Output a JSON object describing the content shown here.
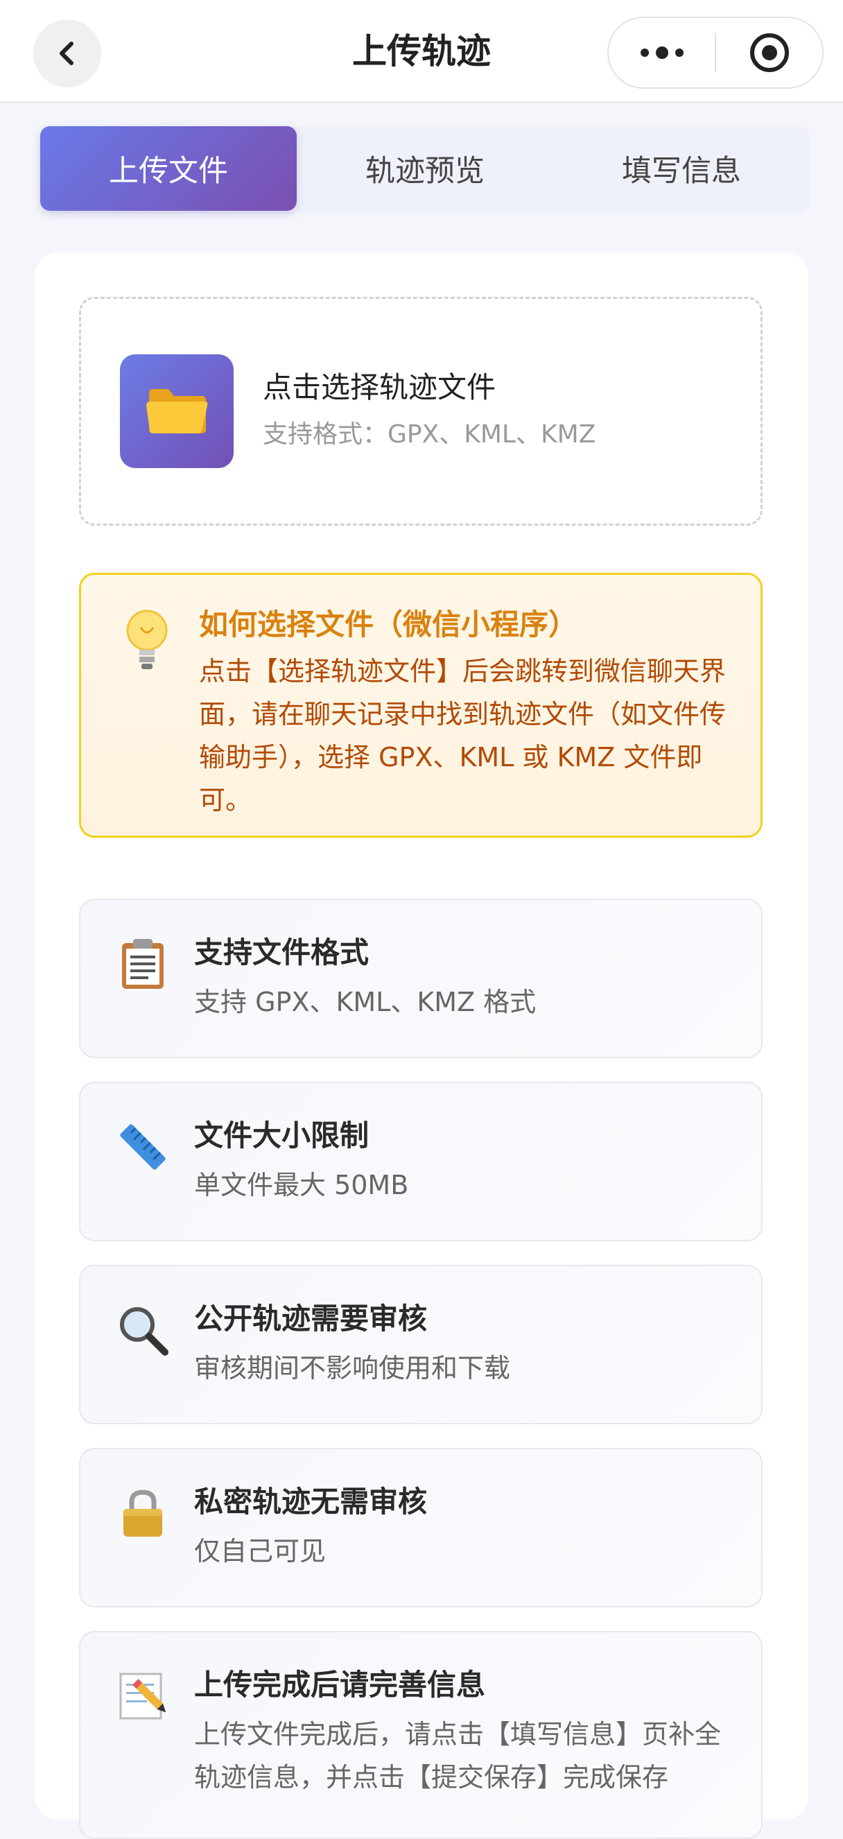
{
  "header": {
    "title": "上传轨迹",
    "back_icon": "back-chevron-icon",
    "more_icon": "more-dots-icon",
    "target_icon": "target-circle-icon"
  },
  "tabs": [
    {
      "label": "上传文件",
      "active": true
    },
    {
      "label": "轨迹预览",
      "active": false
    },
    {
      "label": "填写信息",
      "active": false
    }
  ],
  "upload": {
    "icon": "folder-icon",
    "title": "点击选择轨迹文件",
    "subtitle": "支持格式：GPX、KML、KMZ"
  },
  "tip": {
    "icon": "lightbulb-icon",
    "title": "如何选择文件（微信小程序）",
    "body": "点击【选择轨迹文件】后会跳转到微信聊天界面，请在聊天记录中找到轨迹文件（如文件传输助手），选择 GPX、KML 或 KMZ 文件即可。"
  },
  "info_cards": [
    {
      "icon": "clipboard-icon",
      "title": "支持文件格式",
      "subtitle": "支持 GPX、KML、KMZ 格式"
    },
    {
      "icon": "ruler-icon",
      "title": "文件大小限制",
      "subtitle": "单文件最大 50MB"
    },
    {
      "icon": "magnifier-icon",
      "title": "公开轨迹需要审核",
      "subtitle": "审核期间不影响使用和下载"
    },
    {
      "icon": "lock-icon",
      "title": "私密轨迹无需审核",
      "subtitle": "仅自己可见"
    },
    {
      "icon": "memo-icon",
      "title": "上传完成后请完善信息",
      "subtitle": "上传文件完成后，请点击【填写信息】页补全轨迹信息，并点击【提交保存】完成保存"
    }
  ],
  "colors": {
    "accent_start": "#6a7ae8",
    "accent_end": "#7a4fb0",
    "tip_title": "#d9820f",
    "tip_body": "#b24a05",
    "tip_border": "#f2d21a"
  }
}
